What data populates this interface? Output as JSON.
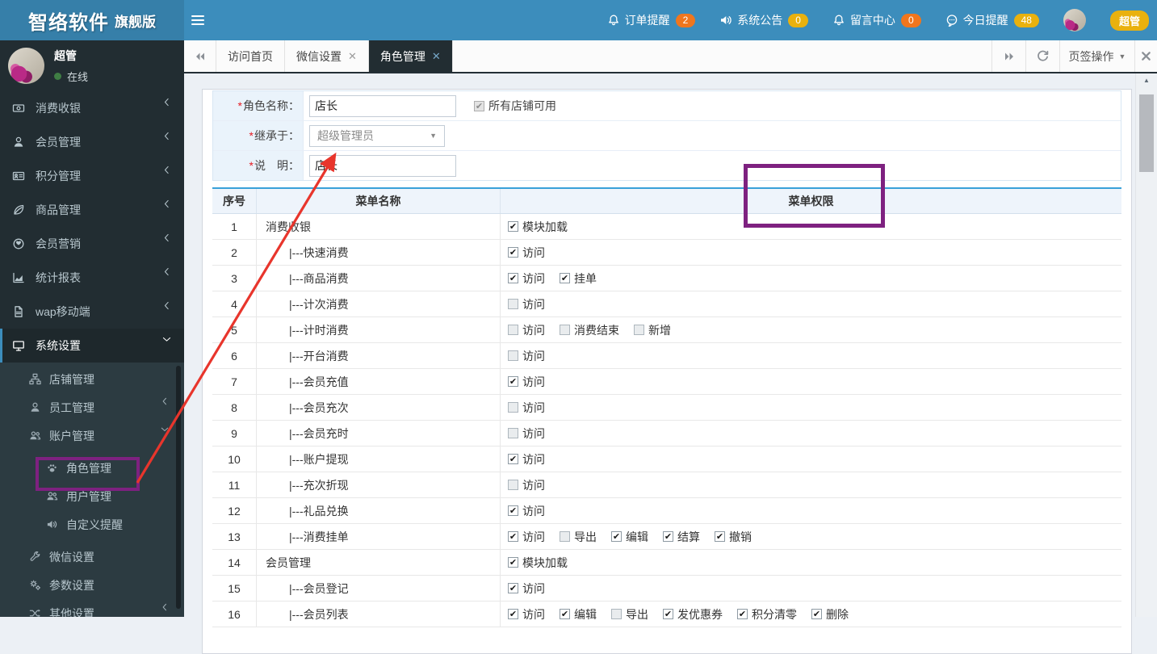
{
  "brand": {
    "name": "智络软件",
    "edition": "旗舰版"
  },
  "topbar": {
    "notifications": [
      {
        "key": "order-reminder",
        "icon": "bell-icon",
        "label": "订单提醒",
        "count": "2",
        "badge": "orange"
      },
      {
        "key": "system-notice",
        "icon": "speaker-icon",
        "label": "系统公告",
        "count": "0",
        "badge": "yellow"
      },
      {
        "key": "message-center",
        "icon": "bell-icon",
        "label": "留言中心",
        "count": "0",
        "badge": "orange"
      },
      {
        "key": "today-reminder",
        "icon": "chat-icon",
        "label": "今日提醒",
        "count": "48",
        "badge": "yellow"
      }
    ],
    "role_badge": "超管"
  },
  "colors": {
    "accent": "#3c8dbc",
    "badge_orange": "#f0761d",
    "badge_yellow": "#e9b10e",
    "highlight_purple": "#7e2180",
    "arrow_red": "#e8352c"
  },
  "sidebar": {
    "user": {
      "name": "超管",
      "status": "在线"
    },
    "menu": [
      {
        "key": "consume-cashier",
        "icon": "money-icon",
        "label": "消费收银",
        "chevron": "left"
      },
      {
        "key": "member-manage",
        "icon": "user-icon",
        "label": "会员管理",
        "chevron": "left"
      },
      {
        "key": "points-manage",
        "icon": "idcard-icon",
        "label": "积分管理",
        "chevron": "left"
      },
      {
        "key": "goods-manage",
        "icon": "leaf-icon",
        "label": "商品管理",
        "chevron": "left"
      },
      {
        "key": "member-marketing",
        "icon": "globe-icon",
        "label": "会员营销",
        "chevron": "left"
      },
      {
        "key": "stats-report",
        "icon": "chart-icon",
        "label": "统计报表",
        "chevron": "left"
      },
      {
        "key": "wap-mobile",
        "icon": "file-icon",
        "label": "wap移动端",
        "chevron": "left"
      },
      {
        "key": "system-settings",
        "icon": "desktop-icon",
        "label": "系统设置",
        "chevron": "down",
        "active": true
      }
    ],
    "submenu": [
      {
        "key": "store-manage",
        "icon": "sitemap-icon",
        "label": "店铺管理",
        "level": 1
      },
      {
        "key": "staff-manage",
        "icon": "user-icon",
        "label": "员工管理",
        "level": 1,
        "chevron": "left"
      },
      {
        "key": "account-manage",
        "icon": "users-icon",
        "label": "账户管理",
        "level": 1,
        "chevron": "down"
      },
      {
        "key": "role-manage",
        "icon": "paw-icon",
        "label": "角色管理",
        "level": 2
      },
      {
        "key": "user-manage",
        "icon": "users-icon",
        "label": "用户管理",
        "level": 2
      },
      {
        "key": "custom-reminder",
        "icon": "volume-icon",
        "label": "自定义提醒",
        "level": 2
      },
      {
        "key": "wechat-settings",
        "icon": "wrench-icon",
        "label": "微信设置",
        "level": 1
      },
      {
        "key": "param-settings",
        "icon": "gears-icon",
        "label": "参数设置",
        "level": 1
      },
      {
        "key": "other-settings",
        "icon": "shuffle-icon",
        "label": "其他设置",
        "level": 1,
        "chevron": "left"
      }
    ]
  },
  "tabbar": {
    "tabs": [
      {
        "key": "home",
        "label": "访问首页",
        "closable": false,
        "active": false
      },
      {
        "key": "wechat-settings",
        "label": "微信设置",
        "closable": true,
        "active": false
      },
      {
        "key": "role-manage",
        "label": "角色管理",
        "closable": true,
        "active": true
      }
    ],
    "ops_label": "页签操作"
  },
  "form": {
    "fields": [
      {
        "key": "role-name",
        "required_mark": "*",
        "label": "角色名称：",
        "control": "input",
        "value": "店长",
        "side_checkbox": {
          "label": "所有店铺可用",
          "checked": true,
          "disabled": true
        }
      },
      {
        "key": "inherit-from",
        "required_mark": "*",
        "label": "继承于：",
        "control": "select",
        "value": "超级管理员"
      },
      {
        "key": "description",
        "required_mark": "*",
        "label": "说　明：",
        "control": "input",
        "value": "店长"
      }
    ]
  },
  "perm_table": {
    "headers": [
      "序号",
      "菜单名称",
      "菜单权限"
    ],
    "rows": [
      {
        "no": "1",
        "name": "消费收银",
        "child": false,
        "perms": [
          {
            "label": "模块加载",
            "checked": true
          }
        ]
      },
      {
        "no": "2",
        "name": "|---快速消费",
        "child": true,
        "perms": [
          {
            "label": "访问",
            "checked": true
          }
        ]
      },
      {
        "no": "3",
        "name": "|---商品消费",
        "child": true,
        "perms": [
          {
            "label": "访问",
            "checked": true
          },
          {
            "label": "挂单",
            "checked": true
          }
        ]
      },
      {
        "no": "4",
        "name": "|---计次消费",
        "child": true,
        "perms": [
          {
            "label": "访问",
            "checked": false
          }
        ]
      },
      {
        "no": "5",
        "name": "|---计时消费",
        "child": true,
        "perms": [
          {
            "label": "访问",
            "checked": false
          },
          {
            "label": "消费结束",
            "checked": false
          },
          {
            "label": "新增",
            "checked": false
          }
        ]
      },
      {
        "no": "6",
        "name": "|---开台消费",
        "child": true,
        "perms": [
          {
            "label": "访问",
            "checked": false
          }
        ]
      },
      {
        "no": "7",
        "name": "|---会员充值",
        "child": true,
        "perms": [
          {
            "label": "访问",
            "checked": true
          }
        ]
      },
      {
        "no": "8",
        "name": "|---会员充次",
        "child": true,
        "perms": [
          {
            "label": "访问",
            "checked": false
          }
        ]
      },
      {
        "no": "9",
        "name": "|---会员充时",
        "child": true,
        "perms": [
          {
            "label": "访问",
            "checked": false
          }
        ]
      },
      {
        "no": "10",
        "name": "|---账户提现",
        "child": true,
        "perms": [
          {
            "label": "访问",
            "checked": true
          }
        ]
      },
      {
        "no": "11",
        "name": "|---充次折现",
        "child": true,
        "perms": [
          {
            "label": "访问",
            "checked": false
          }
        ]
      },
      {
        "no": "12",
        "name": "|---礼品兑换",
        "child": true,
        "perms": [
          {
            "label": "访问",
            "checked": true
          }
        ]
      },
      {
        "no": "13",
        "name": "|---消费挂单",
        "child": true,
        "perms": [
          {
            "label": "访问",
            "checked": true
          },
          {
            "label": "导出",
            "checked": false
          },
          {
            "label": "编辑",
            "checked": true
          },
          {
            "label": "结算",
            "checked": true
          },
          {
            "label": "撤销",
            "checked": true
          }
        ]
      },
      {
        "no": "14",
        "name": "会员管理",
        "child": false,
        "perms": [
          {
            "label": "模块加载",
            "checked": true
          }
        ]
      },
      {
        "no": "15",
        "name": "|---会员登记",
        "child": true,
        "perms": [
          {
            "label": "访问",
            "checked": true
          }
        ]
      },
      {
        "no": "16",
        "name": "|---会员列表",
        "child": true,
        "perms": [
          {
            "label": "访问",
            "checked": true
          },
          {
            "label": "编辑",
            "checked": true
          },
          {
            "label": "导出",
            "checked": false
          },
          {
            "label": "发优惠券",
            "checked": true
          },
          {
            "label": "积分清零",
            "checked": true
          },
          {
            "label": "删除",
            "checked": true
          }
        ]
      }
    ]
  }
}
